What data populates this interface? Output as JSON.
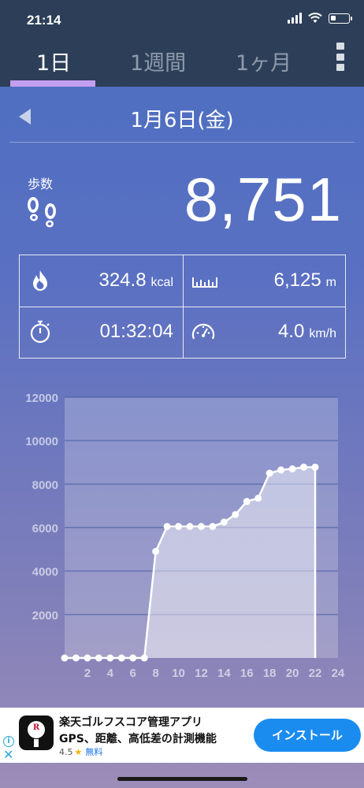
{
  "status": {
    "time": "21:14"
  },
  "tabs": [
    {
      "label": "1日",
      "active": true
    },
    {
      "label": "1週間",
      "active": false
    },
    {
      "label": "1ヶ月",
      "active": false
    }
  ],
  "date_label": "1月6日(金)",
  "steps": {
    "label": "歩数",
    "value": "8,751"
  },
  "stats": {
    "calories": {
      "value": "324.8",
      "unit": "kcal"
    },
    "distance": {
      "value": "6,125",
      "unit": "m"
    },
    "time": {
      "value": "01:32:04"
    },
    "speed": {
      "value": "4.0",
      "unit": "km/h"
    }
  },
  "chart_data": {
    "type": "area",
    "xlim": [
      0,
      24
    ],
    "ylim": [
      0,
      12000
    ],
    "x_ticks": [
      "2",
      "4",
      "6",
      "8",
      "10",
      "12",
      "14",
      "16",
      "18",
      "20",
      "22",
      "24"
    ],
    "y_ticks": [
      "2000",
      "4000",
      "6000",
      "8000",
      "10000",
      "12000"
    ],
    "grid": true,
    "x": [
      0,
      1,
      2,
      3,
      4,
      5,
      6,
      7,
      8,
      9,
      10,
      11,
      12,
      13,
      14,
      15,
      16,
      17,
      18,
      19,
      20,
      21,
      22
    ],
    "values": [
      0,
      0,
      0,
      0,
      0,
      0,
      0,
      0,
      4900,
      6050,
      6050,
      6050,
      6050,
      6050,
      6250,
      6600,
      7200,
      7350,
      8500,
      8650,
      8700,
      8780,
      8780
    ]
  },
  "ad": {
    "title": "楽天ゴルフスコア管理アプリ",
    "subtitle": "GPS、距離、高低差の計測機能",
    "rating": "4.5",
    "free_label": "無料",
    "install_label": "インストール",
    "app_icon_letter": "R"
  },
  "colors": {
    "header_bg": "#2d3f58",
    "tab_underline": "#c49ef0",
    "install_button": "#1a8cf0"
  }
}
